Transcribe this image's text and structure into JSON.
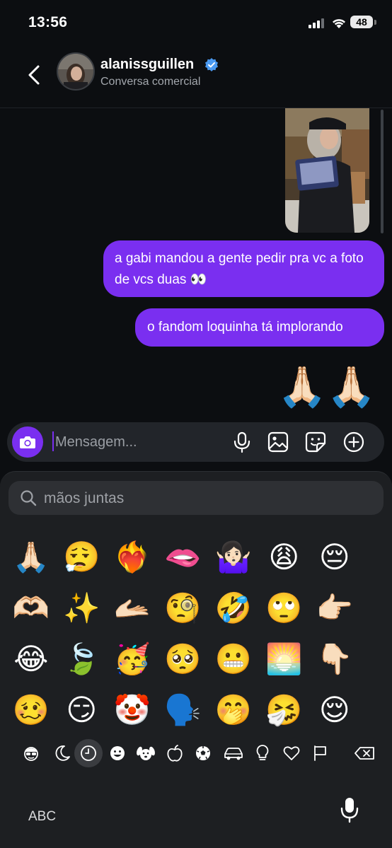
{
  "status_bar": {
    "time": "13:56",
    "battery": "48"
  },
  "header": {
    "username": "alanissguillen",
    "subtitle": "Conversa comercial",
    "verified": true
  },
  "messages": [
    {
      "type": "image",
      "sender": "me"
    },
    {
      "type": "text",
      "sender": "me",
      "text": "a gabi mandou a gente pedir pra vc a foto de vcs duas 👀"
    },
    {
      "type": "text",
      "sender": "me",
      "text": "o fandom loquinha tá implorando"
    },
    {
      "type": "emoji",
      "sender": "me",
      "text": "🙏🏻🙏🏻"
    }
  ],
  "composer": {
    "placeholder": "Mensagem..."
  },
  "emoji_keyboard": {
    "search_value": "mãos juntas",
    "rows": [
      [
        "🙏🏻",
        "😮‍💨",
        "❤️‍🔥",
        "🫦",
        "🤷🏻‍♀️",
        "😩",
        "😔"
      ],
      [
        "🫶🏻",
        "✨",
        "🫴🏻",
        "🧐",
        "🤣",
        "🙄",
        "👉🏻"
      ],
      [
        "😂",
        "🍃",
        "🥳",
        "🥺",
        "😬",
        "🌅",
        "👇🏻"
      ],
      [
        "🥴",
        "😏",
        "🤡",
        "🗣️",
        "🤭",
        "🤧",
        "😌"
      ]
    ],
    "categories": [
      "memoji",
      "moon",
      "recent",
      "smileys",
      "animals",
      "food",
      "activity",
      "travel",
      "objects",
      "symbols",
      "flags"
    ],
    "active_category": "recent",
    "abc_label": "ABC"
  },
  "colors": {
    "accent": "#7a2ff0",
    "background": "#0c0e11",
    "keyboard": "#1d1f22"
  }
}
